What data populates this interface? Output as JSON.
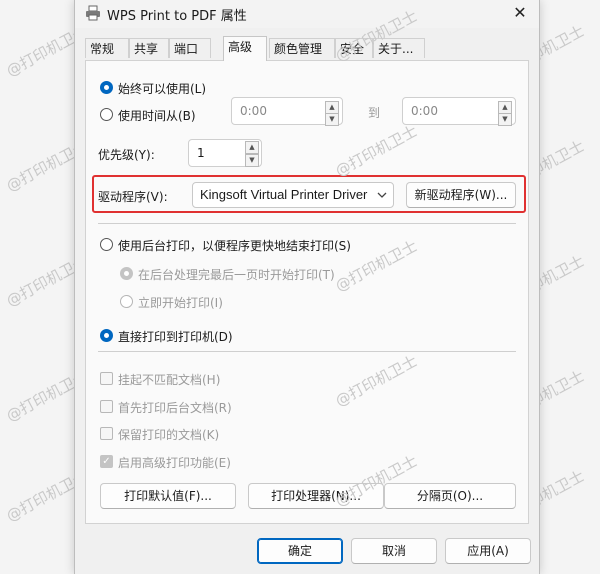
{
  "window": {
    "title": "WPS Print to PDF 属性",
    "close_label": "✕"
  },
  "tabs": [
    {
      "label": "常规"
    },
    {
      "label": "共享"
    },
    {
      "label": "端口"
    },
    {
      "label": "高级"
    },
    {
      "label": "颜色管理"
    },
    {
      "label": "安全"
    },
    {
      "label": "关于..."
    }
  ],
  "availability": {
    "always_label": "始终可以使用(L)",
    "from_label": "使用时间从(B)",
    "from_time": "0:00",
    "to_label": "到",
    "to_time": "0:00"
  },
  "priority": {
    "label": "优先级(Y):",
    "value": "1"
  },
  "driver": {
    "label": "驱动程序(V):",
    "selected": "Kingsoft Virtual Printer Driver",
    "new_button": "新驱动程序(W)..."
  },
  "spool": {
    "spool_label": "使用后台打印，以便程序更快地结束打印(S)",
    "after_last_page_label": "在后台处理完最后一页时开始打印(T)",
    "immediately_label": "立即开始打印(I)",
    "direct_label": "直接打印到打印机(D)"
  },
  "options": {
    "hold_mismatched": "挂起不匹配文档(H)",
    "spooled_first": "首先打印后台文档(R)",
    "keep_printed": "保留打印的文档(K)",
    "advanced_features": "启用高级打印功能(E)"
  },
  "panel_buttons": {
    "defaults": "打印默认值(F)...",
    "processor": "打印处理器(N)...",
    "separator": "分隔页(O)..."
  },
  "dialog_buttons": {
    "ok": "确定",
    "cancel": "取消",
    "apply": "应用(A)"
  },
  "watermark": {
    "text": "@打印机卫士"
  },
  "colors": {
    "accent": "#0067c0",
    "highlight": "#e03131"
  }
}
